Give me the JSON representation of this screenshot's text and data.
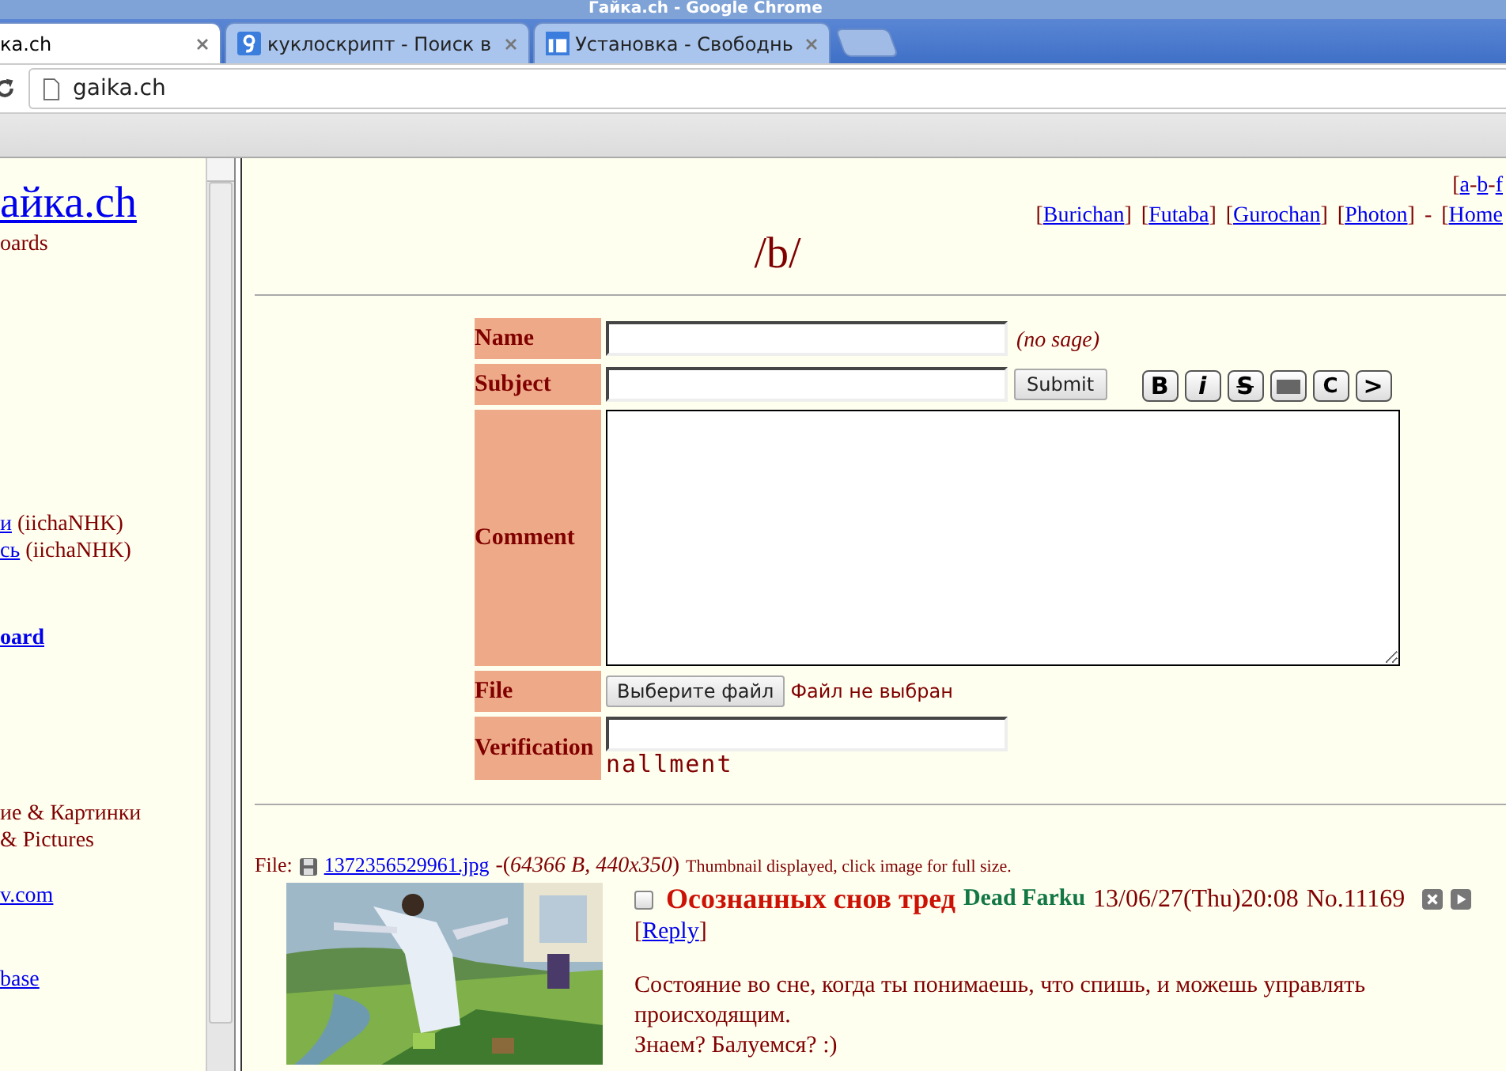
{
  "window": {
    "title": "Гайка.ch - Google Chrome"
  },
  "tabs": [
    {
      "label": "ка.ch",
      "selected": true
    },
    {
      "label": "куклоскрипт - Поиск в",
      "selected": false
    },
    {
      "label": "Установка - Свободнь",
      "selected": false
    }
  ],
  "address_bar": {
    "value": "gaika.ch"
  },
  "left_frame": {
    "items": [
      {
        "kind": "logo",
        "text": "айка.ch"
      },
      {
        "kind": "text",
        "text": "oards"
      },
      {
        "kind": "link_note",
        "link": "и",
        "note": "(iichaNHK)"
      },
      {
        "kind": "link_note",
        "link": "сь",
        "note": "(iichaNHK)"
      },
      {
        "kind": "bold_link",
        "text": "oard"
      },
      {
        "kind": "text",
        "text": "ие & Картинки"
      },
      {
        "kind": "text",
        "text": "& Pictures"
      },
      {
        "kind": "link",
        "text": "v.com"
      },
      {
        "kind": "link",
        "text": "base"
      }
    ]
  },
  "board_nav": {
    "board_links": [
      {
        "kind": "sep",
        "text": "["
      },
      {
        "kind": "link",
        "text": "a"
      },
      {
        "kind": "sep",
        "text": "-"
      },
      {
        "kind": "link",
        "text": "b"
      },
      {
        "kind": "sep",
        "text": "-"
      },
      {
        "kind": "link",
        "text": "f"
      }
    ],
    "style_links": [
      {
        "kind": "sep",
        "text": "["
      },
      {
        "kind": "link",
        "text": "Burichan"
      },
      {
        "kind": "sep",
        "text": "]"
      },
      {
        "kind": "sep",
        "text": "["
      },
      {
        "kind": "link",
        "text": "Futaba"
      },
      {
        "kind": "sep",
        "text": "]"
      },
      {
        "kind": "sep",
        "text": "["
      },
      {
        "kind": "link",
        "text": "Gurochan"
      },
      {
        "kind": "sep",
        "text": "]"
      },
      {
        "kind": "sep",
        "text": "["
      },
      {
        "kind": "link",
        "text": "Photon"
      },
      {
        "kind": "sep",
        "text": "]"
      },
      {
        "kind": "sep",
        "text": "-"
      },
      {
        "kind": "sep",
        "text": "["
      },
      {
        "kind": "link",
        "text": "Home"
      }
    ]
  },
  "board_title": "/b/",
  "form": {
    "name_label": "Name",
    "name_note": "(no sage)",
    "subject_label": "Subject",
    "submit": "Submit",
    "format_buttons": [
      {
        "kind": "bold",
        "text": "B"
      },
      {
        "kind": "italic",
        "text": "i"
      },
      {
        "kind": "strike",
        "text": "S"
      },
      {
        "kind": "spoiler"
      },
      {
        "kind": "code",
        "text": "C"
      },
      {
        "kind": "quote",
        "text": ">"
      }
    ],
    "comment_label": "Comment",
    "file_label": "File",
    "file_button": "Выберите файл",
    "file_status": "Файл не выбран",
    "verification_label": "Verification",
    "captcha": "nallment"
  },
  "post": {
    "file_label": "File:",
    "file_name": "1372356529961.jpg",
    "file_meta": "-(*64366 B, 440x350*)",
    "thumb_note": "Thumbnail displayed, click image for full size.",
    "checked": false,
    "subject": "Осознанных снов тред",
    "author": "Dead Farku",
    "date": "13/06/27(Thu)20:08",
    "number": "No.11169",
    "reply_open": "[",
    "reply": "Reply",
    "reply_close": "]",
    "message": [
      "Состояние во сне, когда ты понимаешь, что спишь, и можешь управлять происходящим.",
      "Знаем? Балуемся? :)"
    ]
  }
}
